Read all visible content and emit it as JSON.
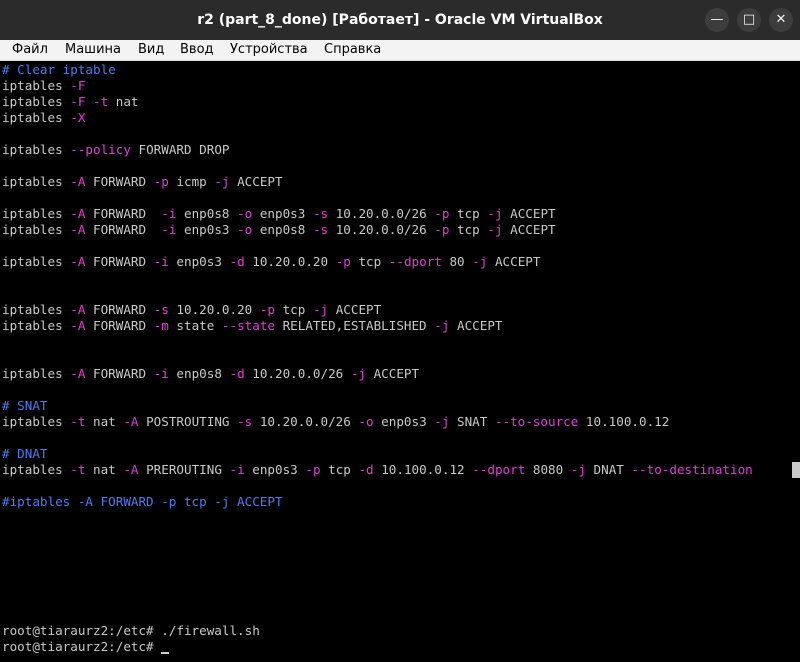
{
  "window": {
    "title": "r2 (part_8_done) [Работает] - Oracle VM VirtualBox",
    "minimize_glyph": "—",
    "maximize_glyph": "□",
    "close_glyph": "✕"
  },
  "menu": [
    "Файл",
    "Машина",
    "Вид",
    "Ввод",
    "Устройства",
    "Справка"
  ],
  "terminal": {
    "lines": [
      [
        {
          "t": "# Clear iptable",
          "c": "c"
        }
      ],
      [
        {
          "t": "iptables ",
          "c": "t"
        },
        {
          "t": "-F",
          "c": "m"
        }
      ],
      [
        {
          "t": "iptables ",
          "c": "t"
        },
        {
          "t": "-F",
          "c": "m"
        },
        {
          "t": " ",
          "c": "t"
        },
        {
          "t": "-t",
          "c": "m"
        },
        {
          "t": " nat",
          "c": "t"
        }
      ],
      [
        {
          "t": "iptables ",
          "c": "t"
        },
        {
          "t": "-X",
          "c": "m"
        }
      ],
      [],
      [
        {
          "t": "iptables ",
          "c": "t"
        },
        {
          "t": "--policy",
          "c": "m"
        },
        {
          "t": " FORWARD DROP",
          "c": "t"
        }
      ],
      [],
      [
        {
          "t": "iptables ",
          "c": "t"
        },
        {
          "t": "-A",
          "c": "m"
        },
        {
          "t": " FORWARD ",
          "c": "t"
        },
        {
          "t": "-p",
          "c": "m"
        },
        {
          "t": " icmp ",
          "c": "t"
        },
        {
          "t": "-j",
          "c": "m"
        },
        {
          "t": " ACCEPT",
          "c": "t"
        }
      ],
      [],
      [
        {
          "t": "iptables ",
          "c": "t"
        },
        {
          "t": "-A",
          "c": "m"
        },
        {
          "t": " FORWARD  ",
          "c": "t"
        },
        {
          "t": "-i",
          "c": "m"
        },
        {
          "t": " enp0s8 ",
          "c": "t"
        },
        {
          "t": "-o",
          "c": "m"
        },
        {
          "t": " enp0s3 ",
          "c": "t"
        },
        {
          "t": "-s",
          "c": "m"
        },
        {
          "t": " 10.20.0.0/26 ",
          "c": "t"
        },
        {
          "t": "-p",
          "c": "m"
        },
        {
          "t": " tcp ",
          "c": "t"
        },
        {
          "t": "-j",
          "c": "m"
        },
        {
          "t": " ACCEPT",
          "c": "t"
        }
      ],
      [
        {
          "t": "iptables ",
          "c": "t"
        },
        {
          "t": "-A",
          "c": "m"
        },
        {
          "t": " FORWARD  ",
          "c": "t"
        },
        {
          "t": "-i",
          "c": "m"
        },
        {
          "t": " enp0s3 ",
          "c": "t"
        },
        {
          "t": "-o",
          "c": "m"
        },
        {
          "t": " enp0s8 ",
          "c": "t"
        },
        {
          "t": "-s",
          "c": "m"
        },
        {
          "t": " 10.20.0.0/26 ",
          "c": "t"
        },
        {
          "t": "-p",
          "c": "m"
        },
        {
          "t": " tcp ",
          "c": "t"
        },
        {
          "t": "-j",
          "c": "m"
        },
        {
          "t": " ACCEPT",
          "c": "t"
        }
      ],
      [],
      [
        {
          "t": "iptables ",
          "c": "t"
        },
        {
          "t": "-A",
          "c": "m"
        },
        {
          "t": " FORWARD ",
          "c": "t"
        },
        {
          "t": "-i",
          "c": "m"
        },
        {
          "t": " enp0s3 ",
          "c": "t"
        },
        {
          "t": "-d",
          "c": "m"
        },
        {
          "t": " 10.20.0.20 ",
          "c": "t"
        },
        {
          "t": "-p",
          "c": "m"
        },
        {
          "t": " tcp ",
          "c": "t"
        },
        {
          "t": "--dport",
          "c": "m"
        },
        {
          "t": " 80 ",
          "c": "t"
        },
        {
          "t": "-j",
          "c": "m"
        },
        {
          "t": " ACCEPT",
          "c": "t"
        }
      ],
      [],
      [],
      [
        {
          "t": "iptables ",
          "c": "t"
        },
        {
          "t": "-A",
          "c": "m"
        },
        {
          "t": " FORWARD ",
          "c": "t"
        },
        {
          "t": "-s",
          "c": "m"
        },
        {
          "t": " 10.20.0.20 ",
          "c": "t"
        },
        {
          "t": "-p",
          "c": "m"
        },
        {
          "t": " tcp ",
          "c": "t"
        },
        {
          "t": "-j",
          "c": "m"
        },
        {
          "t": " ACCEPT",
          "c": "t"
        }
      ],
      [
        {
          "t": "iptables ",
          "c": "t"
        },
        {
          "t": "-A",
          "c": "m"
        },
        {
          "t": " FORWARD ",
          "c": "t"
        },
        {
          "t": "-m",
          "c": "m"
        },
        {
          "t": " state ",
          "c": "t"
        },
        {
          "t": "--state",
          "c": "m"
        },
        {
          "t": " RELATED,ESTABLISHED ",
          "c": "t"
        },
        {
          "t": "-j",
          "c": "m"
        },
        {
          "t": " ACCEPT",
          "c": "t"
        }
      ],
      [],
      [],
      [
        {
          "t": "iptables ",
          "c": "t"
        },
        {
          "t": "-A",
          "c": "m"
        },
        {
          "t": " FORWARD ",
          "c": "t"
        },
        {
          "t": "-i",
          "c": "m"
        },
        {
          "t": " enp0s8 ",
          "c": "t"
        },
        {
          "t": "-d",
          "c": "m"
        },
        {
          "t": " 10.20.0.0/26 ",
          "c": "t"
        },
        {
          "t": "-j",
          "c": "m"
        },
        {
          "t": " ACCEPT",
          "c": "t"
        }
      ],
      [],
      [
        {
          "t": "# SNAT",
          "c": "c"
        }
      ],
      [
        {
          "t": "iptables ",
          "c": "t"
        },
        {
          "t": "-t",
          "c": "m"
        },
        {
          "t": " nat ",
          "c": "t"
        },
        {
          "t": "-A",
          "c": "m"
        },
        {
          "t": " POSTROUTING ",
          "c": "t"
        },
        {
          "t": "-s",
          "c": "m"
        },
        {
          "t": " 10.20.0.0/26 ",
          "c": "t"
        },
        {
          "t": "-o",
          "c": "m"
        },
        {
          "t": " enp0s3 ",
          "c": "t"
        },
        {
          "t": "-j",
          "c": "m"
        },
        {
          "t": " SNAT ",
          "c": "t"
        },
        {
          "t": "--to-source",
          "c": "m"
        },
        {
          "t": " 10.100.0.12",
          "c": "t"
        }
      ],
      [],
      [
        {
          "t": "# DNAT",
          "c": "c"
        }
      ],
      [
        {
          "t": "iptables ",
          "c": "t"
        },
        {
          "t": "-t",
          "c": "m"
        },
        {
          "t": " nat ",
          "c": "t"
        },
        {
          "t": "-A",
          "c": "m"
        },
        {
          "t": " PREROUTING ",
          "c": "t"
        },
        {
          "t": "-i",
          "c": "m"
        },
        {
          "t": " enp0s3 ",
          "c": "t"
        },
        {
          "t": "-p",
          "c": "m"
        },
        {
          "t": " tcp ",
          "c": "t"
        },
        {
          "t": "-d",
          "c": "m"
        },
        {
          "t": " 10.100.0.12 ",
          "c": "t"
        },
        {
          "t": "--dport",
          "c": "m"
        },
        {
          "t": " 8080 ",
          "c": "t"
        },
        {
          "t": "-j",
          "c": "m"
        },
        {
          "t": " DNAT ",
          "c": "t"
        },
        {
          "t": "--to-destination",
          "c": "m"
        }
      ],
      [],
      [
        {
          "t": "#iptables -A FORWARD -p tcp -j ACCEPT",
          "c": "c"
        }
      ]
    ],
    "prompt_lines": [
      "root@tiaraurz2:/etc# ./firewall.sh",
      "root@tiaraurz2:/etc# "
    ]
  }
}
